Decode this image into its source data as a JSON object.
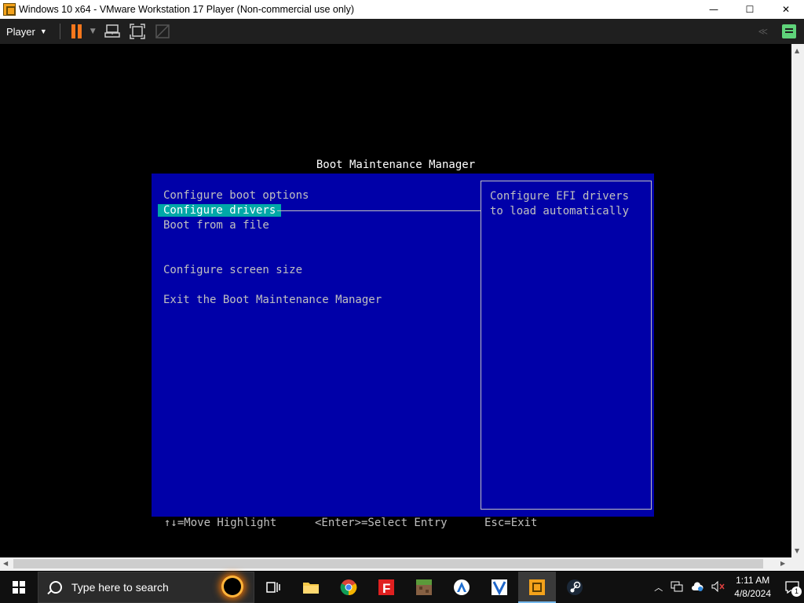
{
  "window": {
    "title": "Windows 10 x64 - VMware Workstation 17 Player (Non-commercial use only)",
    "minimize": "—",
    "maximize": "☐",
    "close": "✕"
  },
  "toolbar": {
    "player_label": "Player",
    "icons": [
      "pause-icon",
      "send-ctrl-alt-del-icon",
      "fit-guest-icon",
      "unity-icon",
      "message-log-icon"
    ]
  },
  "bios": {
    "title": "Boot Maintenance Manager",
    "menu": [
      "Configure boot options",
      "Configure drivers",
      "Boot from a file",
      "Configure screen size",
      "Exit the Boot Maintenance Manager"
    ],
    "selected_index": 1,
    "help_text": "Configure EFI drivers\nto load automatically",
    "footer": {
      "move": "↑↓=Move Highlight",
      "select": "<Enter>=Select Entry",
      "exit": "Esc=Exit"
    },
    "colors": {
      "background": "#0000a8",
      "highlight": "#00a8a8",
      "text": "#c0c0c0"
    }
  },
  "taskbar": {
    "search_placeholder": "Type here to search",
    "apps": [
      "task-view-icon",
      "file-explorer-icon",
      "chrome-icon",
      "foxit-icon",
      "minecraft-icon",
      "app-icon",
      "vmware-icon-taskbar",
      "vmware-player-icon",
      "steam-icon"
    ],
    "time": "1:11 AM",
    "date": "4/8/2024",
    "notification_count": "1"
  }
}
